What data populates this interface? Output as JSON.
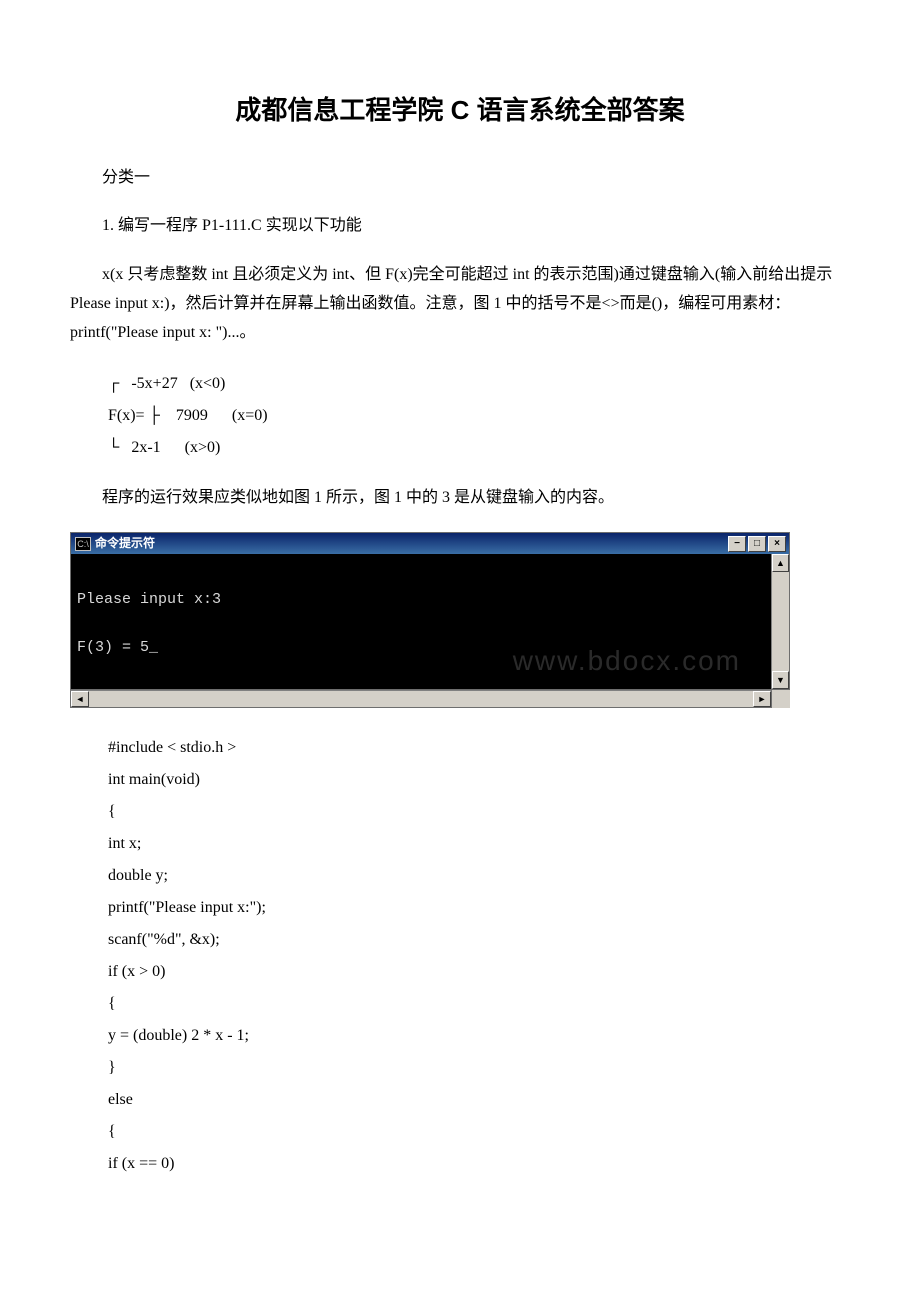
{
  "title": "成都信息工程学院 C 语言系统全部答案",
  "intro": {
    "category": "分类一",
    "task_heading": "1. 编写一程序 P1-111.C 实现以下功能",
    "description": "x(x 只考虑整数 int 且必须定义为 int、但 F(x)完全可能超过 int 的表示范围)通过键盘输入(输入前给出提示 Please input x:)，然后计算并在屏幕上输出函数值。注意，图 1 中的括号不是<>而是()，编程可用素材：printf(\"Please input x: \")...。"
  },
  "piecewise": {
    "left": "F(x)=",
    "rows": [
      "┌   -5x+27   (x<0)",
      "├    7909      (x=0)",
      "└   2x-1      (x>0)"
    ]
  },
  "run_note": "程序的运行效果应类似地如图 1 所示，图 1 中的 3 是从键盘输入的内容。",
  "console": {
    "icon_text": "C:\\",
    "title": "命令提示符",
    "lines": [
      "Please input x:3",
      "F(3) = 5"
    ],
    "watermark": "www.bdocx.com"
  },
  "code": [
    "#include < stdio.h >",
    "int main(void)",
    "{",
    "int x;",
    "double y;",
    "printf(\"Please input x:\");",
    "scanf(\"%d\", &x);",
    "if (x > 0)",
    "{",
    "y = (double) 2 * x - 1;",
    "}",
    "else",
    "{",
    "if (x == 0)"
  ]
}
